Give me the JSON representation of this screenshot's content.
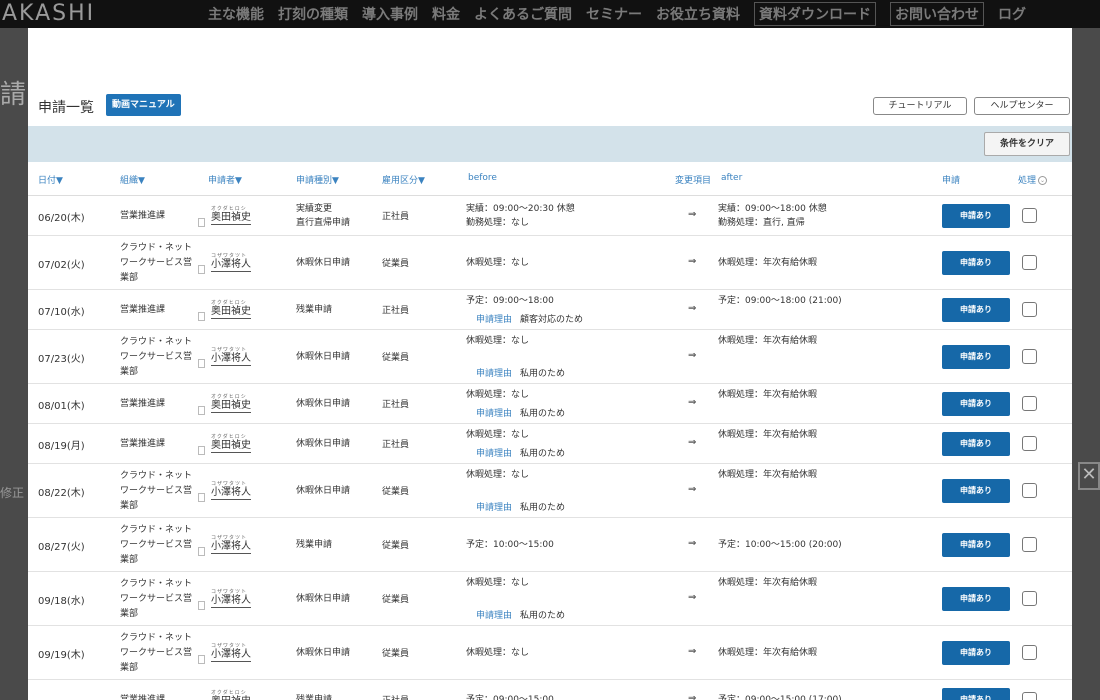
{
  "background": {
    "logo": "AKASHI",
    "nav": [
      "主な機能",
      "打刻の種類",
      "導入事例",
      "料金",
      "よくあるご質問",
      "セミナー",
      "お役立ち資料",
      "資料ダウンロード",
      "お問い合わせ",
      "ログ"
    ],
    "left_title": "請",
    "left_fragment": "修正"
  },
  "modal": {
    "title": "申請一覧",
    "manual_button": "動画マニュアル",
    "tutorial_button": "チュートリアル",
    "help_button": "ヘルプセンター",
    "clear_button": "条件をクリア"
  },
  "headers": {
    "date": "日付▼",
    "org": "組織▼",
    "applicant": "申請者▼",
    "type": "申請種別▼",
    "employment": "雇用区分▼",
    "before": "before",
    "change": "変更項目",
    "after": "after",
    "apply": "申請",
    "process": "処理"
  },
  "rows": [
    {
      "date": "06/20(木)",
      "org": "営業推進課",
      "kana": "オクダヒロシ",
      "name": "奥田禎史",
      "type": [
        "実績変更",
        "直行直帰申請"
      ],
      "emp": "正社員",
      "before": [
        "実績：09:00〜20:30 休憩",
        "勤務処理：なし"
      ],
      "reason_label": "",
      "reason": "",
      "arrow": "⇒",
      "after": [
        "実績：09:00〜18:00 休憩",
        "勤務処理：直行, 直帰"
      ],
      "apply": "申請あり"
    },
    {
      "date": "07/02(火)",
      "org": "クラウド・ネットワークサービス営業部",
      "kana": "コザワタツト",
      "name": "小澤将人",
      "type": [
        "休暇休日申請"
      ],
      "emp": "従業員",
      "before": [
        "休暇処理：なし"
      ],
      "reason_label": "",
      "reason": "",
      "arrow": "⇒",
      "after": [
        "休暇処理：年次有給休暇"
      ],
      "apply": "申請あり"
    },
    {
      "date": "07/10(水)",
      "org": "営業推進課",
      "kana": "オクダヒロシ",
      "name": "奥田禎史",
      "type": [
        "残業申請"
      ],
      "emp": "正社員",
      "before": [
        "予定：09:00〜18:00"
      ],
      "reason_label": "申請理由",
      "reason": "顧客対応のため",
      "arrow": "⇒",
      "after": [
        "予定：09:00〜18:00 (21:00)"
      ],
      "apply": "申請あり"
    },
    {
      "date": "07/23(火)",
      "org": "クラウド・ネットワークサービス営業部",
      "kana": "コザワタツト",
      "name": "小澤将人",
      "type": [
        "休暇休日申請"
      ],
      "emp": "従業員",
      "before": [
        "休暇処理：なし"
      ],
      "reason_label": "申請理由",
      "reason": "私用のため",
      "arrow": "⇒",
      "after": [
        "休暇処理：年次有給休暇"
      ],
      "apply": "申請あり"
    },
    {
      "date": "08/01(木)",
      "org": "営業推進課",
      "kana": "オクダヒロシ",
      "name": "奥田禎史",
      "type": [
        "休暇休日申請"
      ],
      "emp": "正社員",
      "before": [
        "休暇処理：なし"
      ],
      "reason_label": "申請理由",
      "reason": "私用のため",
      "arrow": "⇒",
      "after": [
        "休暇処理：年次有給休暇"
      ],
      "apply": "申請あり"
    },
    {
      "date": "08/19(月)",
      "org": "営業推進課",
      "kana": "オクダヒロシ",
      "name": "奥田禎史",
      "type": [
        "休暇休日申請"
      ],
      "emp": "正社員",
      "before": [
        "休暇処理：なし"
      ],
      "reason_label": "申請理由",
      "reason": "私用のため",
      "arrow": "⇒",
      "after": [
        "休暇処理：年次有給休暇"
      ],
      "apply": "申請あり"
    },
    {
      "date": "08/22(木)",
      "org": "クラウド・ネットワークサービス営業部",
      "kana": "コザワタツト",
      "name": "小澤将人",
      "type": [
        "休暇休日申請"
      ],
      "emp": "従業員",
      "before": [
        "休暇処理：なし"
      ],
      "reason_label": "申請理由",
      "reason": "私用のため",
      "arrow": "⇒",
      "after": [
        "休暇処理：年次有給休暇"
      ],
      "apply": "申請あり"
    },
    {
      "date": "08/27(火)",
      "org": "クラウド・ネットワークサービス営業部",
      "kana": "コザワタツト",
      "name": "小澤将人",
      "type": [
        "残業申請"
      ],
      "emp": "従業員",
      "before": [
        "予定：10:00〜15:00"
      ],
      "reason_label": "",
      "reason": "",
      "arrow": "⇒",
      "after": [
        "予定：10:00〜15:00 (20:00)"
      ],
      "apply": "申請あり"
    },
    {
      "date": "09/18(水)",
      "org": "クラウド・ネットワークサービス営業部",
      "kana": "コザワタツト",
      "name": "小澤将人",
      "type": [
        "休暇休日申請"
      ],
      "emp": "従業員",
      "before": [
        "休暇処理：なし"
      ],
      "reason_label": "申請理由",
      "reason": "私用のため",
      "arrow": "⇒",
      "after": [
        "休暇処理：年次有給休暇"
      ],
      "apply": "申請あり"
    },
    {
      "date": "09/19(木)",
      "org": "クラウド・ネットワークサービス営業部",
      "kana": "コザワタツト",
      "name": "小澤将人",
      "type": [
        "休暇休日申請"
      ],
      "emp": "従業員",
      "before": [
        "休暇処理：なし"
      ],
      "reason_label": "",
      "reason": "",
      "arrow": "⇒",
      "after": [
        "休暇処理：年次有給休暇"
      ],
      "apply": "申請あり"
    },
    {
      "date": "",
      "org": "営業推進課",
      "kana": "オクダヒロシ",
      "name": "奥田禎史",
      "type": [
        "残業申請"
      ],
      "emp": "正社員",
      "before": [
        "予定：09:00〜15:00"
      ],
      "reason_label": "",
      "reason": "",
      "arrow": "⇒",
      "after": [
        "予定：09:00〜15:00 (17:00)"
      ],
      "apply": "申請あり"
    }
  ]
}
